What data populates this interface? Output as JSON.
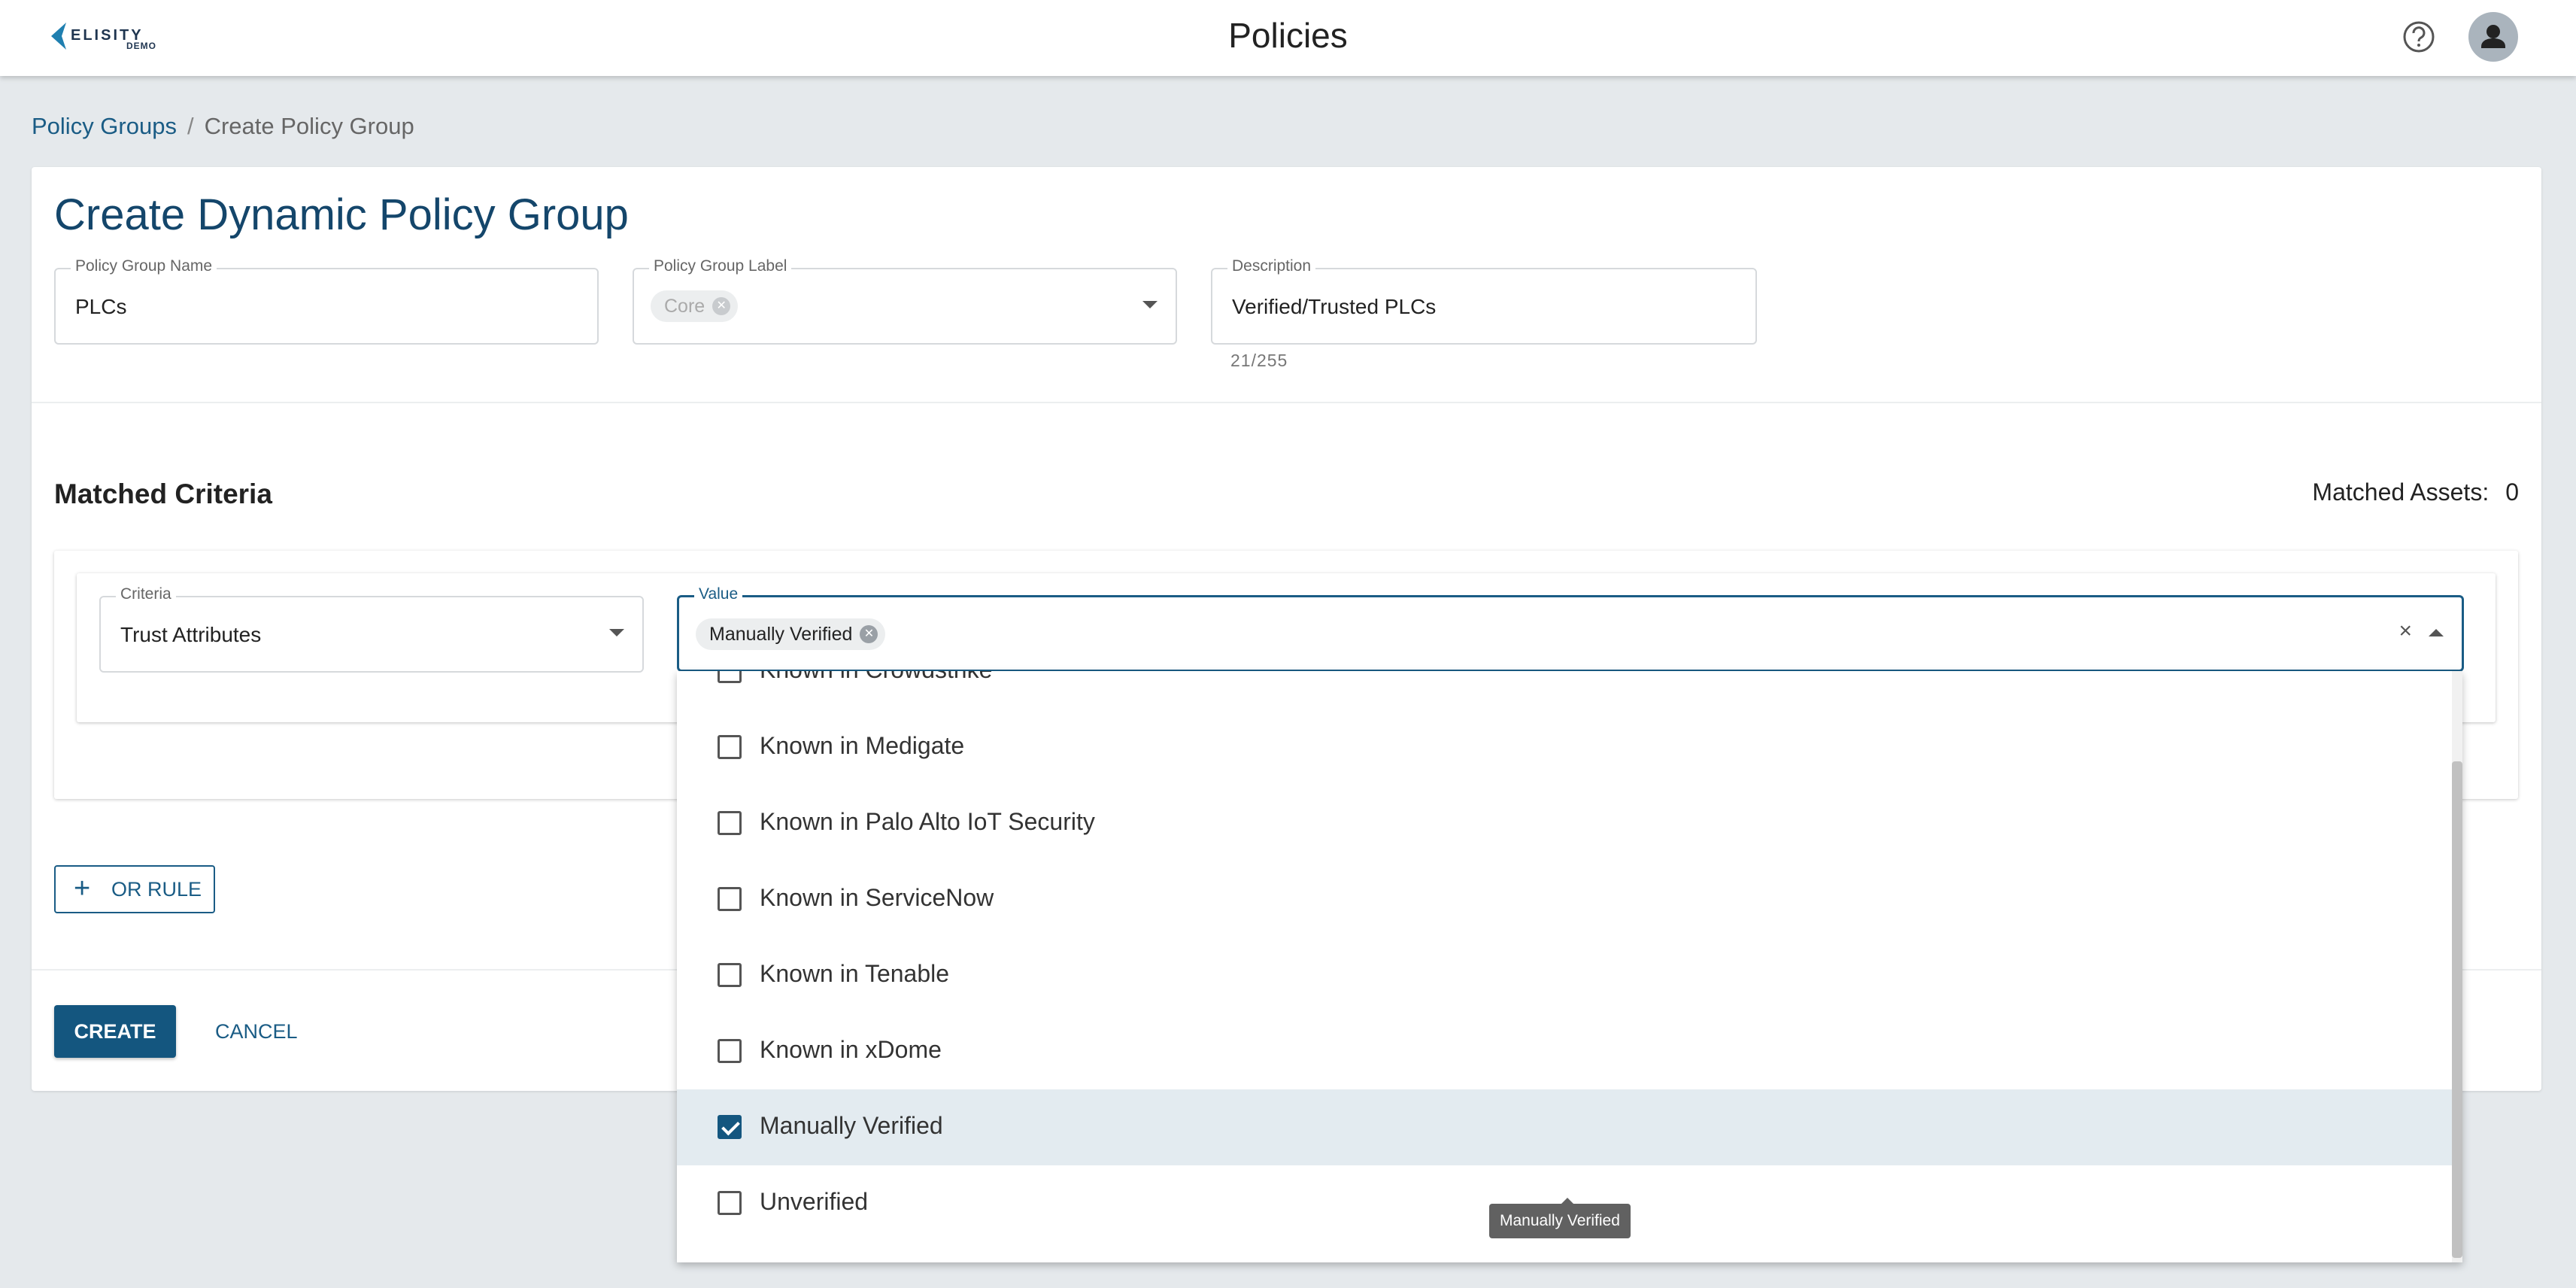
{
  "header": {
    "logo_text": "ELISITY",
    "logo_sub": "DEMO",
    "title": "Policies"
  },
  "breadcrumb": {
    "parent": "Policy Groups",
    "separator": "/",
    "current": "Create Policy Group"
  },
  "form": {
    "title": "Create Dynamic Policy Group",
    "name": {
      "label": "Policy Group Name",
      "value": "PLCs"
    },
    "group_label": {
      "label": "Policy Group Label",
      "chip": "Core"
    },
    "description": {
      "label": "Description",
      "value": "Verified/Trusted PLCs",
      "counter": "21/255"
    }
  },
  "matched": {
    "title": "Matched Criteria",
    "assets_label": "Matched Assets:",
    "assets_count": "0"
  },
  "criteria": {
    "label": "Criteria",
    "value": "Trust Attributes"
  },
  "value_field": {
    "label": "Value",
    "chip": "Manually Verified"
  },
  "buttons": {
    "or_rule": "OR RULE",
    "create": "CREATE",
    "cancel": "CANCEL"
  },
  "options": [
    {
      "label": "Known in Crowdstrike",
      "checked": false
    },
    {
      "label": "Known in Medigate",
      "checked": false
    },
    {
      "label": "Known in Palo Alto IoT Security",
      "checked": false
    },
    {
      "label": "Known in ServiceNow",
      "checked": false
    },
    {
      "label": "Known in Tenable",
      "checked": false
    },
    {
      "label": "Known in xDome",
      "checked": false
    },
    {
      "label": "Manually Verified",
      "checked": true
    },
    {
      "label": "Unverified",
      "checked": false
    }
  ],
  "tooltip": "Manually Verified",
  "colors": {
    "primary": "#14567f",
    "accent_text": "#1a5c85",
    "background": "#e5e9ec",
    "selected_row": "#e3ebf0"
  }
}
